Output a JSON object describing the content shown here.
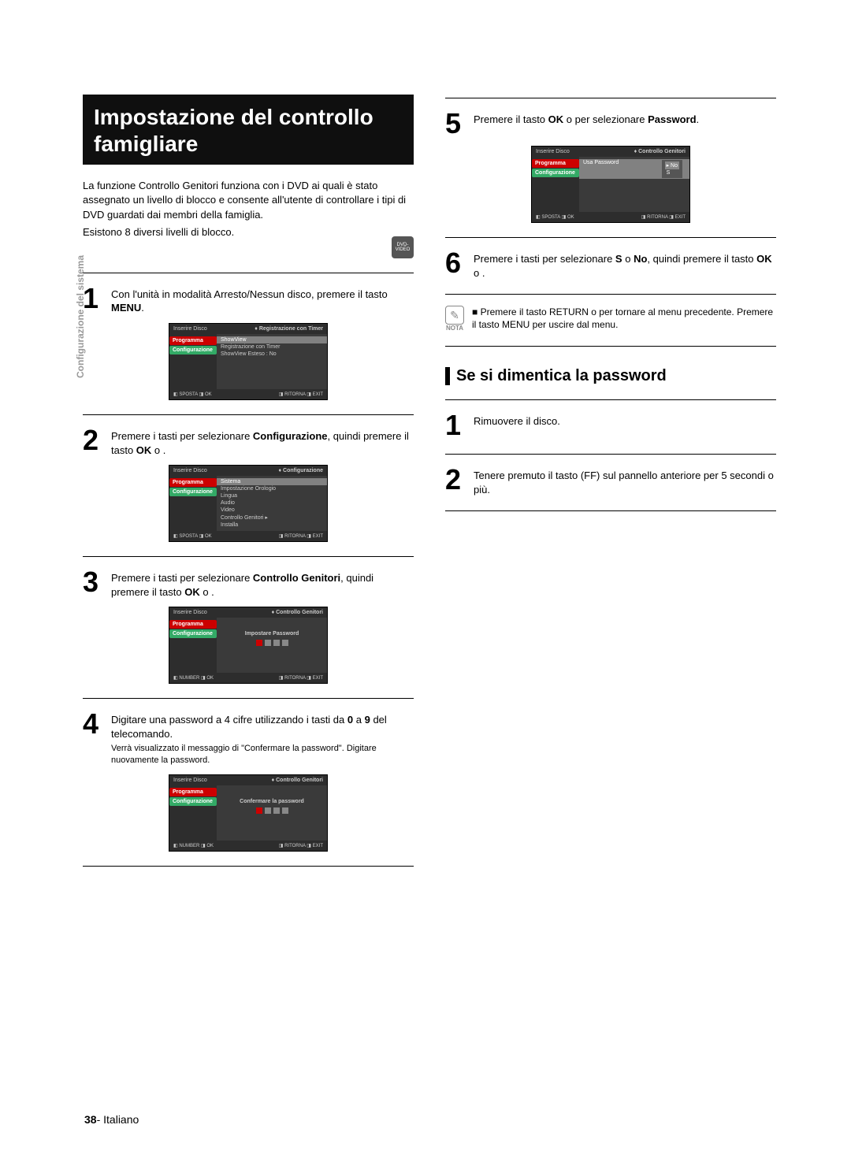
{
  "sideLabel": "Configurazione del sistema",
  "title": "Impostazione del controllo famigliare",
  "intro1": "La funzione Controllo Genitori  funziona con i DVD ai quali è stato assegnato un livello di blocco e consente all'utente di controllare i tipi di DVD guardati dai membri della famiglia.",
  "intro2": "Esistono 8 diversi livelli di blocco.",
  "dvdIcon": "DVD-VIDEO",
  "stepL1": {
    "n": "1",
    "t": "Con l'unità in modalità Arresto/Nessun disco, premere il tasto <b>MENU</b>."
  },
  "stepL2": {
    "n": "2",
    "t": "Premere i tasti       per selezionare <b>Configurazione</b>, quindi premere il tasto <b>OK</b> o    ."
  },
  "stepL3": {
    "n": "3",
    "t": "Premere i tasti       per selezionare <b>Controllo Genitori</b>, quindi premere il tasto <b>OK</b> o    ."
  },
  "stepL4": {
    "n": "4",
    "t": "Digitare una password a 4 cifre utilizzando i tasti da <b>0</b> a <b>9</b> del telecomando.",
    "s": "Verrà visualizzato il messaggio di \"Confermare la password\". Digitare nuovamente la password."
  },
  "stepR5": {
    "n": "5",
    "t": "Premere il tasto <b>OK</b> o      per selezionare <b>Password</b>."
  },
  "stepR6": {
    "n": "6",
    "t": "Premere i tasti       per selezionare <b>S</b>  o <b>No</b>, quindi premere il tasto <b>OK</b> o    ."
  },
  "note": {
    "label": "NOTA",
    "text": "Premere il tasto RETURN o      per tornare al menu precedente. Premere il tasto MENU per uscire dal menu."
  },
  "forgot": {
    "title": "Se si dimentica la password",
    "s1": {
      "n": "1",
      "t": "Rimuovere il disco."
    },
    "s2": {
      "n": "2",
      "t": "Tenere premuto il tasto        (FF) sul pannello anteriore per 5 secondi o più."
    }
  },
  "osd": {
    "topLeft": "Inserire Disco",
    "tabs": {
      "prog": "Programma",
      "conf": "Configurazione"
    },
    "bot": {
      "sposta": "SPOSTA",
      "ok": "OK",
      "ritorna": "RITORNA",
      "exit": "EXIT",
      "number": "NUMBER"
    },
    "s1": {
      "topRight": "Registrazione con Timer",
      "rows": [
        "ShowView",
        "Registrazione con Timer",
        "ShowView Esteso : No"
      ]
    },
    "s2": {
      "topRight": "Configurazione",
      "rows": [
        "Sistema",
        "Impostazione Orologio",
        "Lingua",
        "Audio",
        "Video",
        "Controllo Genitori  ▸",
        "Installa"
      ]
    },
    "s3": {
      "topRight": "Controllo Genitori",
      "center": "Impostare Password"
    },
    "s4": {
      "topRight": "Controllo Genitori",
      "center": "Confermare la password"
    },
    "s5": {
      "topRight": "Controllo Genitori",
      "label": "Usa Password",
      "opts": [
        "No",
        "S"
      ]
    }
  },
  "footer": {
    "page": "38",
    "sep": "- ",
    "lang": "Italiano"
  }
}
